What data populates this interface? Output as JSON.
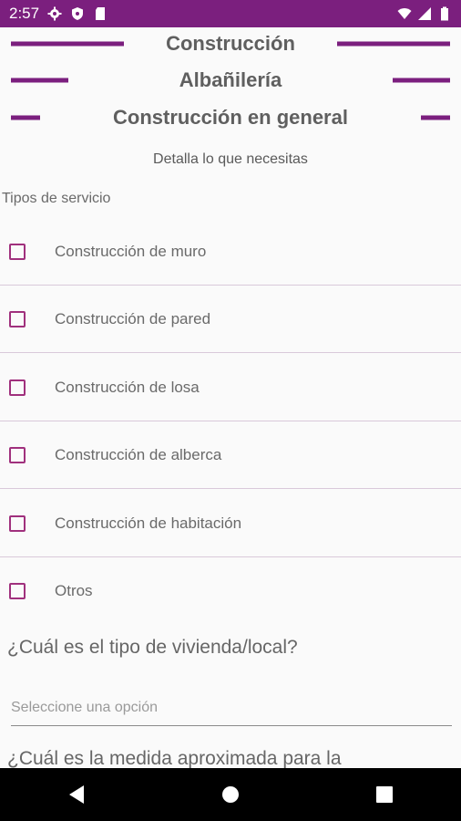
{
  "status": {
    "time": "2:57"
  },
  "headings": {
    "category": "Construcción",
    "subcategory": "Albañilería",
    "service": "Construcción en general"
  },
  "subtitle": "Detalla lo que necesitas",
  "service_types_label": "Tipos de servicio",
  "options": [
    {
      "label": "Construcción de muro",
      "checked": false
    },
    {
      "label": "Construcción de pared",
      "checked": false
    },
    {
      "label": "Construcción de losa",
      "checked": false
    },
    {
      "label": "Construcción de alberca",
      "checked": false
    },
    {
      "label": "Construcción de habitación",
      "checked": false
    },
    {
      "label": "Otros",
      "checked": false
    }
  ],
  "question_dwelling": "¿Cuál es el tipo de vivienda/local?",
  "select": {
    "placeholder": "Seleccione una opción"
  },
  "question_measure": "¿Cuál es la medida aproximada para la",
  "colors": {
    "primary": "#7b1f7e",
    "checkbox": "#a0307d"
  },
  "icons": [
    "settings-icon",
    "shield-icon",
    "sd-card-icon",
    "wifi-icon",
    "signal-icon",
    "battery-icon",
    "back-icon",
    "home-icon",
    "recents-icon"
  ]
}
